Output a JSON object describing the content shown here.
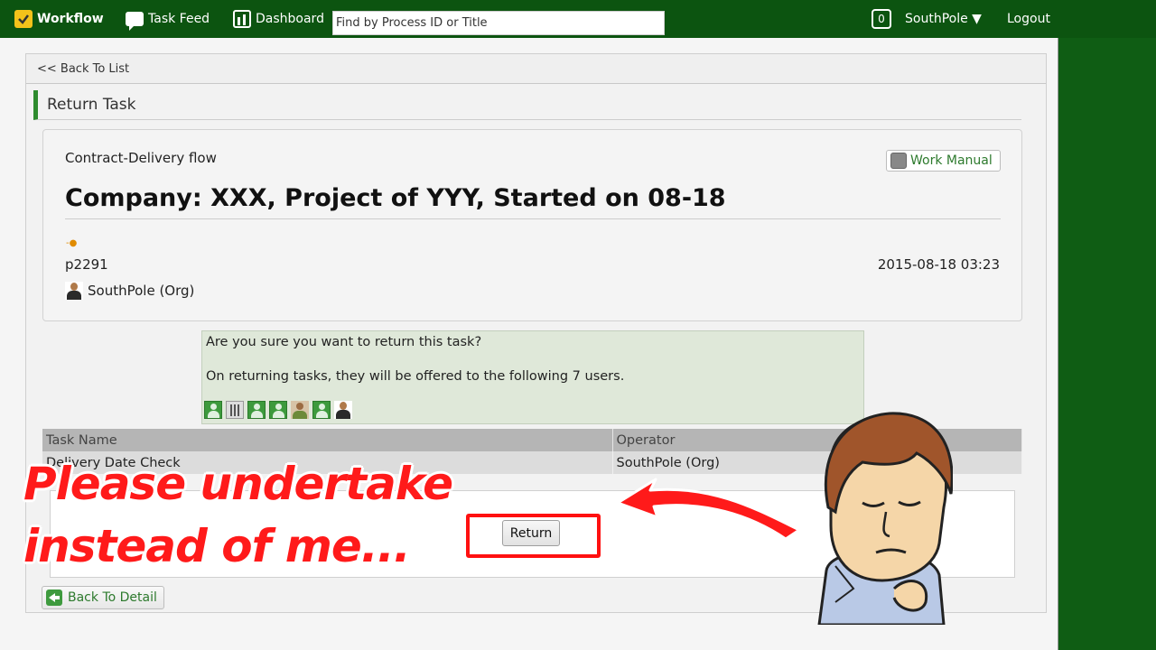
{
  "topbar": {
    "app_name": "Workflow",
    "task_feed": "Task Feed",
    "dashboard": "Dashboard",
    "search_placeholder": "Find by Process ID or Title",
    "badge_count": "0",
    "user_menu": "SouthPole ▼",
    "logout": "Logout"
  },
  "nav": {
    "back_to_list": "<< Back To List",
    "section_title": "Return Task"
  },
  "process": {
    "flow_name": "Contract-Delivery flow",
    "work_manual": "Work Manual",
    "title": "Company: XXX, Project of YYY, Started on 08-18",
    "status_mark": "-●",
    "process_id": "p2291",
    "started_at": "2015-08-18 03:23",
    "owner": "SouthPole (Org)"
  },
  "confirm": {
    "question": "Are you sure you want to return this task?",
    "info": "On returning tasks, they will be offered to the following 7 users.",
    "user_avatars": [
      "green",
      "grey",
      "green",
      "green",
      "photo",
      "green",
      "person"
    ]
  },
  "task_table": {
    "headers": [
      "Task Name",
      "Operator"
    ],
    "rows": [
      [
        "Delivery Date Check",
        "SouthPole (Org)"
      ]
    ]
  },
  "actions": {
    "return_label": "Return",
    "back_to_detail": "Back To Detail"
  },
  "annotation": {
    "line1": "Please undertake",
    "line2": "instead of me..."
  },
  "colors": {
    "topbar": "#0c5410",
    "accent_green": "#2e8b2e",
    "annotation_red": "#ff1a1a"
  }
}
